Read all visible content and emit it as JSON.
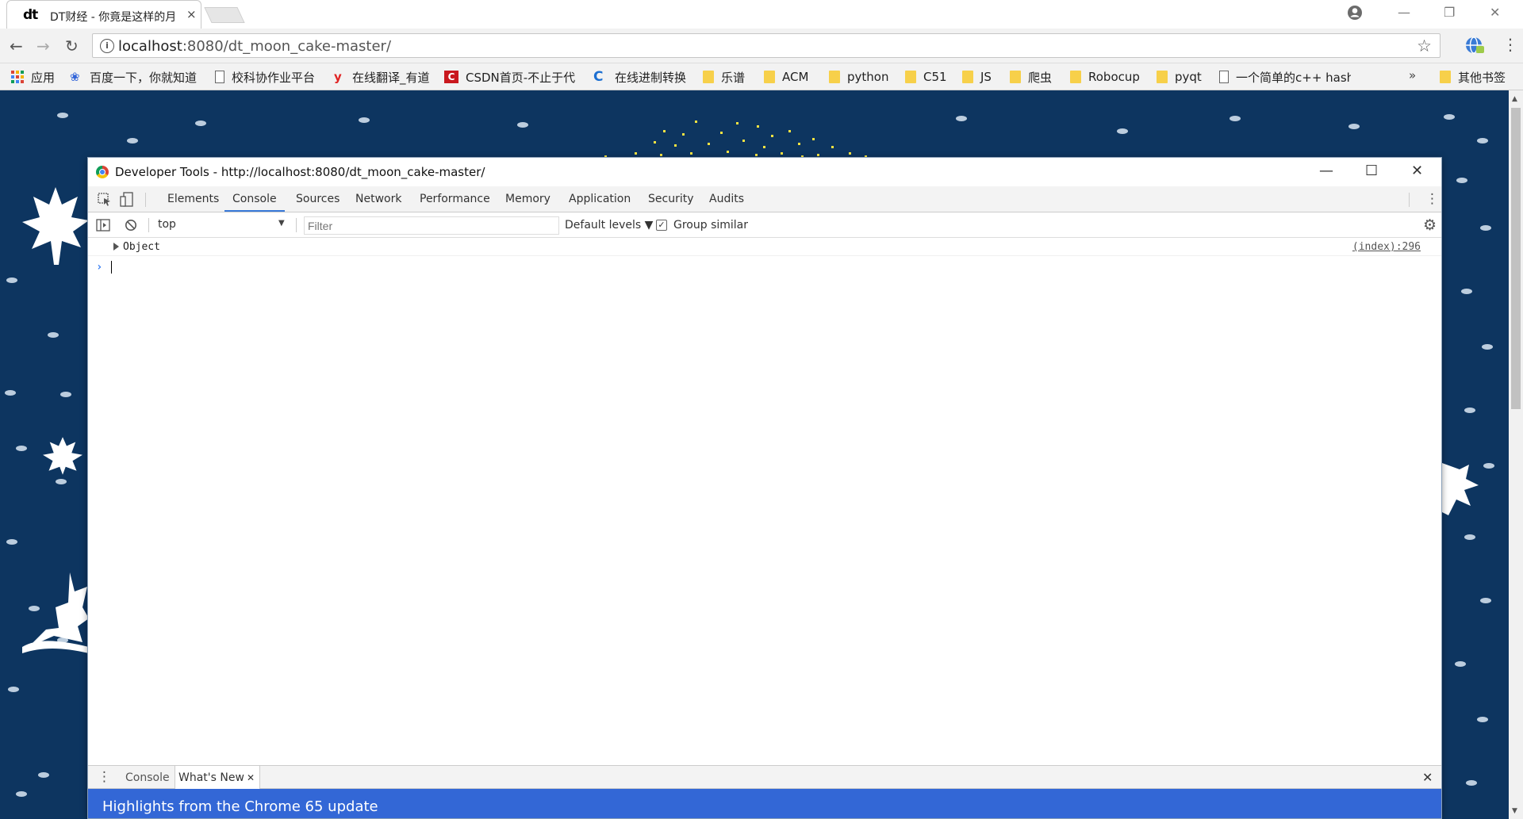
{
  "browser": {
    "tab": {
      "favicon_text": "dt",
      "title": "DT财经 - 你竟是这样的月",
      "close_glyph": "×"
    },
    "omnibox": {
      "url_host": "localhost",
      "url_path": ":8080/dt_moon_cake-master/"
    },
    "bookmarks": [
      {
        "label": "应用",
        "icon": "apps-icon"
      },
      {
        "label": "百度一下，你就知道",
        "icon": "baidu-paw-icon"
      },
      {
        "label": "校科协作业平台",
        "icon": "page-icon"
      },
      {
        "label": "在线翻译_有道",
        "icon": "youdao-icon"
      },
      {
        "label": "CSDN首页-不止于代",
        "icon": "csdn-icon"
      },
      {
        "label": "在线进制转换",
        "icon": "c-logo-icon"
      },
      {
        "label": "乐谱",
        "icon": "folder-icon"
      },
      {
        "label": "ACM",
        "icon": "folder-icon"
      },
      {
        "label": "python",
        "icon": "folder-icon"
      },
      {
        "label": "C51",
        "icon": "folder-icon"
      },
      {
        "label": "JS",
        "icon": "folder-icon"
      },
      {
        "label": "爬虫",
        "icon": "folder-icon"
      },
      {
        "label": "Robocup",
        "icon": "folder-icon"
      },
      {
        "label": "pyqt",
        "icon": "folder-icon"
      },
      {
        "label": "一个简单的c++ hash",
        "icon": "page-icon"
      }
    ],
    "bookmarks_overflow": "»",
    "other_bookmarks": "其他书签"
  },
  "devtools": {
    "window_title": "Developer Tools - http://localhost:8080/dt_moon_cake-master/",
    "tabs": [
      "Elements",
      "Console",
      "Sources",
      "Network",
      "Performance",
      "Memory",
      "Application",
      "Security",
      "Audits"
    ],
    "active_tab": "Console",
    "console_toolbar": {
      "context": "top",
      "filter_placeholder": "Filter",
      "levels": "Default levels ▼",
      "group_similar": "Group similar",
      "group_similar_checked": true
    },
    "log": {
      "entry": "Object",
      "source": "(index):296"
    },
    "prompt": "›",
    "drawer": {
      "tabs": [
        "Console",
        "What's New"
      ],
      "active": "What's New",
      "tab_close": "✕",
      "close": "✕"
    },
    "whats_new_heading": "Highlights from the Chrome 65 update"
  },
  "colors": {
    "page_bg": "#0d3560",
    "accent_blue": "#3879d9",
    "banner_blue": "#3367d6",
    "folder_yellow": "#f7d04a"
  }
}
